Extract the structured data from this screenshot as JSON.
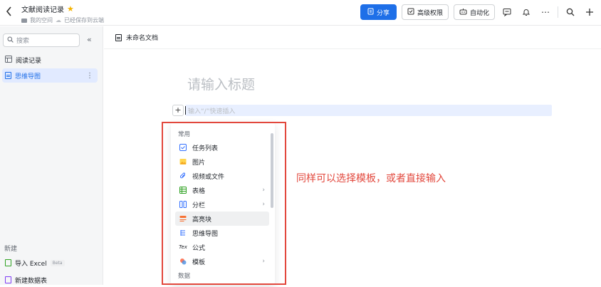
{
  "topbar": {
    "back_icon": "chevron-left-icon",
    "title": "文献阅读记录",
    "star_icon": "star-icon",
    "location": "我的空间",
    "save_status": "已经保存到云端",
    "share_label": "分享",
    "permission_label": "高级权限",
    "automation_label": "自动化",
    "accent_color": "#1e6fe8"
  },
  "sidebar": {
    "search_placeholder": "搜索",
    "items": [
      {
        "label": "阅读记录",
        "icon": "table-icon"
      },
      {
        "label": "思维导图",
        "icon": "doc-icon"
      }
    ],
    "new_label": "新建",
    "new_items": [
      {
        "label": "导入 Excel",
        "badge": "Beta",
        "icon": "excel-icon"
      },
      {
        "label": "新建数据表",
        "icon": "database-icon"
      }
    ]
  },
  "doc": {
    "breadcrumb": "未命名文档",
    "title_placeholder": "请输入标题",
    "input_placeholder": "输入“/”快速插入"
  },
  "menu": {
    "section_common": "常用",
    "items": [
      {
        "label": "任务列表",
        "icon": "checkbox-icon",
        "color": "#3370ff"
      },
      {
        "label": "图片",
        "icon": "image-icon",
        "color": "#f5b300"
      },
      {
        "label": "视频或文件",
        "icon": "paperclip-icon",
        "color": "#3370ff"
      },
      {
        "label": "表格",
        "icon": "table-icon",
        "color": "#2ea121",
        "submenu": true
      },
      {
        "label": "分栏",
        "icon": "columns-icon",
        "color": "#3370ff",
        "submenu": true
      },
      {
        "label": "高亮块",
        "icon": "highlight-icon",
        "color": "#f77234"
      },
      {
        "label": "思维导图",
        "icon": "mindmap-icon",
        "color": "#3370ff"
      },
      {
        "label": "公式",
        "icon": "formula-icon",
        "color": "#1f2329"
      },
      {
        "label": "模板",
        "icon": "template-icon",
        "color": "#e2473c",
        "submenu": true
      }
    ],
    "section_data": "数据"
  },
  "annotation": {
    "text": "同样可以选择模板，或者直接输入",
    "color": "#e2473c"
  }
}
